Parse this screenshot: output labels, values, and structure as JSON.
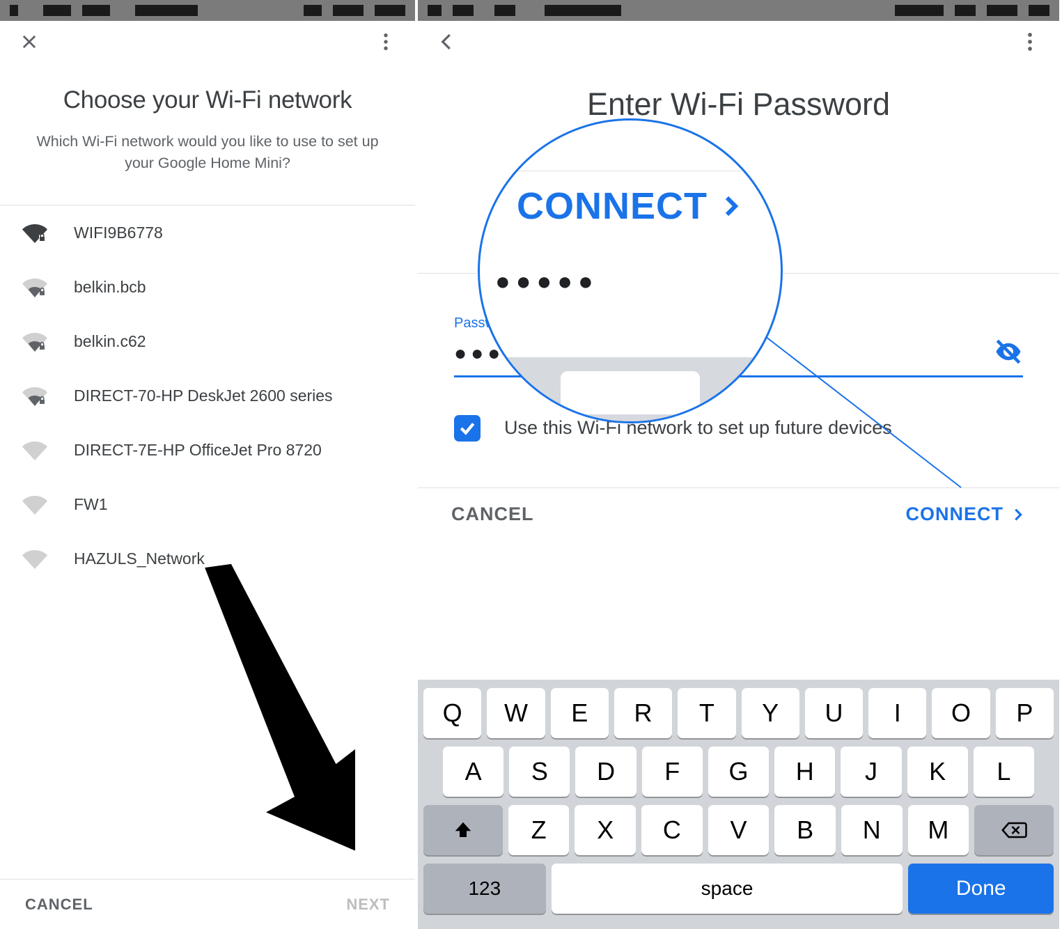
{
  "left": {
    "title": "Choose your Wi-Fi network",
    "subtitle": "Which Wi-Fi network would you like to use to set up your Google Home Mini?",
    "networks": [
      {
        "name": "WIFI9B6778",
        "signal": "strong",
        "locked": true
      },
      {
        "name": "belkin.bcb",
        "signal": "weak",
        "locked": true
      },
      {
        "name": "belkin.c62",
        "signal": "weak",
        "locked": true
      },
      {
        "name": "DIRECT-70-HP DeskJet 2600 series",
        "signal": "weak",
        "locked": true
      },
      {
        "name": "DIRECT-7E-HP OfficeJet Pro 8720",
        "signal": "none",
        "locked": false
      },
      {
        "name": "FW1",
        "signal": "none",
        "locked": false
      },
      {
        "name": "HAZULS_Network",
        "signal": "none",
        "locked": false
      }
    ],
    "cancel_label": "CANCEL",
    "next_label": "NEXT"
  },
  "right": {
    "title": "Enter Wi-Fi Password",
    "password_label": "Passw",
    "password_value": "●●●●●",
    "checkbox_label": "Use this Wi-Fi network to set up future devices",
    "checkbox_checked": true,
    "cancel_label": "CANCEL",
    "connect_label": "CONNECT",
    "magnifier_connect": "CONNECT",
    "keyboard": {
      "row1": [
        "Q",
        "W",
        "E",
        "R",
        "T",
        "Y",
        "U",
        "I",
        "O",
        "P"
      ],
      "row2": [
        "A",
        "S",
        "D",
        "F",
        "G",
        "H",
        "J",
        "K",
        "L"
      ],
      "row3": [
        "Z",
        "X",
        "C",
        "V",
        "B",
        "N",
        "M"
      ],
      "numeric_label": "123",
      "space_label": "space",
      "done_label": "Done"
    }
  }
}
